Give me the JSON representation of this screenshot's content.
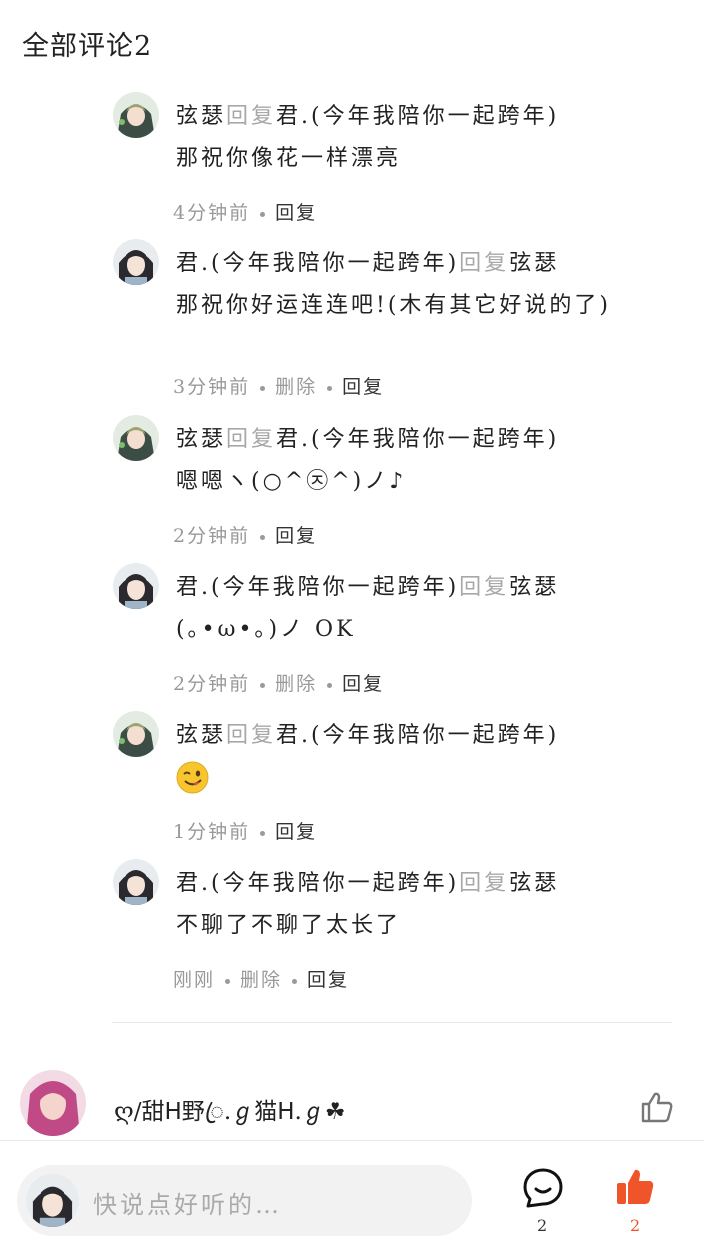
{
  "header": {
    "title": "全部评论2"
  },
  "replies": [
    {
      "from": "弦瑟",
      "reply_word": "回复",
      "to": "君.(今年我陪你一起跨年)",
      "message": "那祝你像花一样漂亮",
      "time": "4分钟前",
      "delete": "",
      "reply": "回复"
    },
    {
      "from": "君.(今年我陪你一起跨年)",
      "reply_word": "回复",
      "to": "弦瑟",
      "message": "那祝你好运连连吧!(木有其它好说的了)",
      "time": "3分钟前",
      "delete": "删除",
      "reply": "回复"
    },
    {
      "from": "弦瑟",
      "reply_word": "回复",
      "to": "君.(今年我陪你一起跨年)",
      "message": "嗯嗯ヽ(○^㉨^)ノ♪",
      "time": "2分钟前",
      "delete": "",
      "reply": "回复"
    },
    {
      "from": "君.(今年我陪你一起跨年)",
      "reply_word": "回复",
      "to": "弦瑟",
      "message": "(｡•ω•｡)ノ OK",
      "time": "2分钟前",
      "delete": "删除",
      "reply": "回复"
    },
    {
      "from": "弦瑟",
      "reply_word": "回复",
      "to": "君.(今年我陪你一起跨年)",
      "message": "",
      "emoji": "winking-face",
      "time": "1分钟前",
      "delete": "",
      "reply": "回复"
    },
    {
      "from": "君.(今年我陪你一起跨年)",
      "reply_word": "回复",
      "to": "弦瑟",
      "message": "不聊了不聊了太长了",
      "time": "刚刚",
      "delete": "删除",
      "reply": "回复"
    }
  ],
  "next_comment": {
    "name": "ღ/甜ᕼ野ꦿ.ℊ猫ᕼ.ℊ☘"
  },
  "bottom_bar": {
    "placeholder": "快说点好听的…",
    "comment_count": "2",
    "like_count": "2",
    "accent": "#f0552a"
  },
  "icons": [
    "avatar-green-hood",
    "avatar-dark-hair",
    "avatar-pink-hair",
    "thumbs-up-outline-icon",
    "comment-bubble-icon",
    "thumbs-up-filled-icon"
  ]
}
